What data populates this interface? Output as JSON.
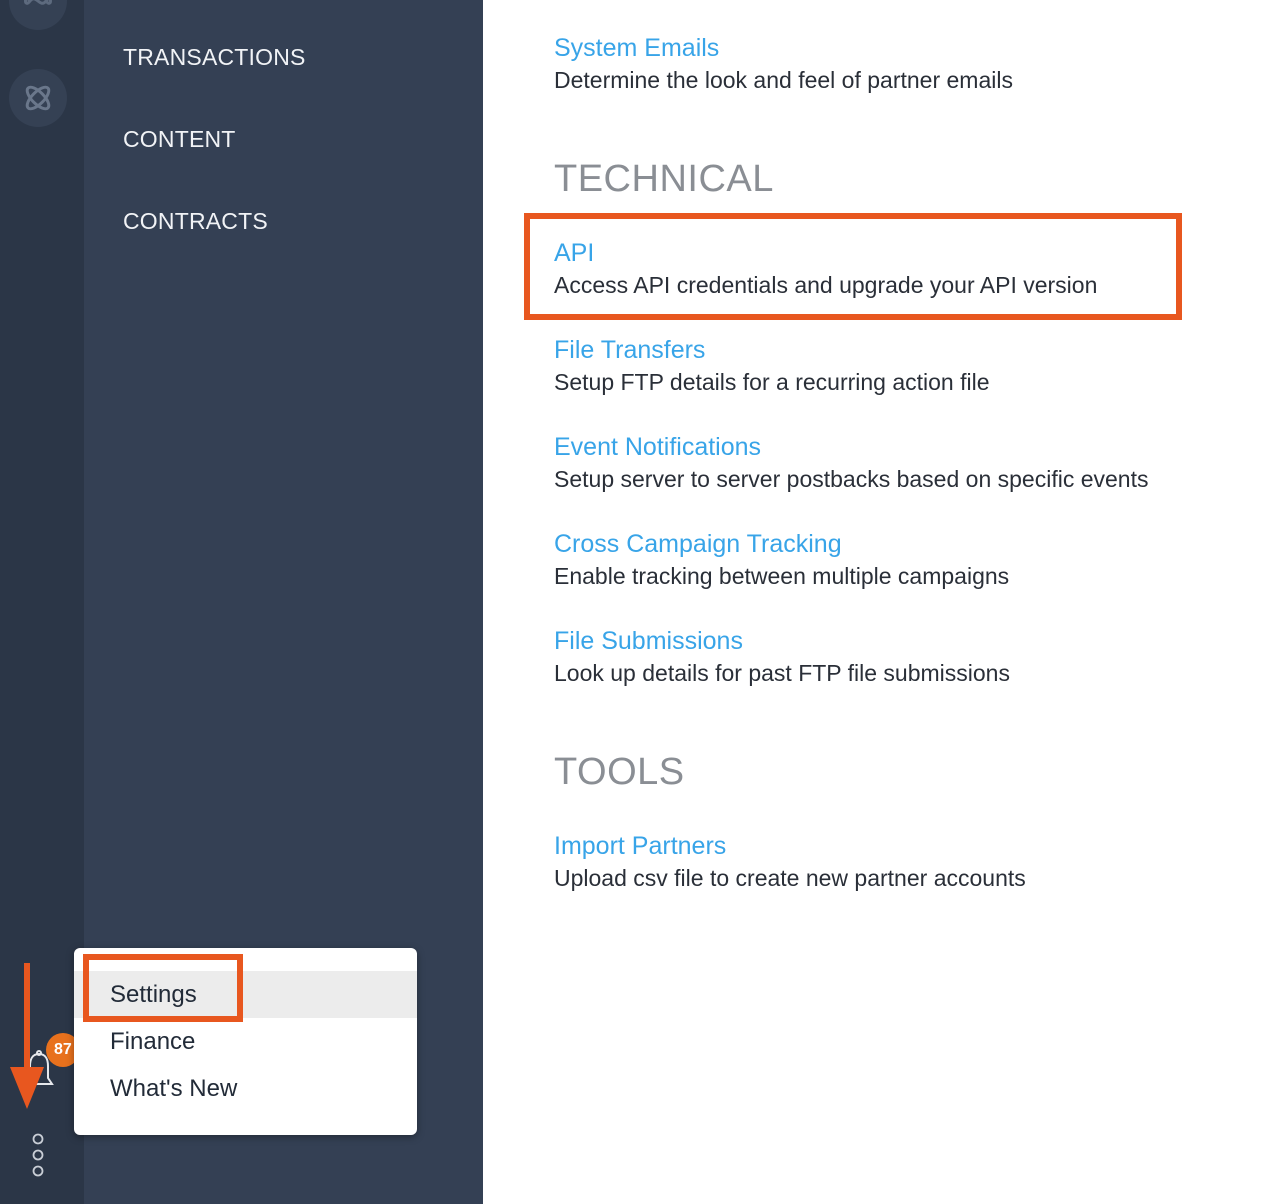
{
  "nav": {
    "items": [
      {
        "label": "TRANSACTIONS"
      },
      {
        "label": "CONTENT"
      },
      {
        "label": "CONTRACTS"
      }
    ]
  },
  "rail": {
    "notification_count": "87",
    "icons": [
      "infinity-icon",
      "atom-icon",
      "bell-icon",
      "more-dots-icon"
    ]
  },
  "popup_menu": {
    "items": [
      {
        "label": "Settings",
        "selected": true
      },
      {
        "label": "Finance"
      },
      {
        "label": "What's New"
      }
    ]
  },
  "content": {
    "top_item": {
      "title": "System Emails",
      "description": "Determine the look and feel of partner emails"
    },
    "sections": [
      {
        "heading": "TECHNICAL",
        "items": [
          {
            "title": "API",
            "description": "Access API credentials and upgrade your API version"
          },
          {
            "title": "File Transfers",
            "description": "Setup FTP details for a recurring action file"
          },
          {
            "title": "Event Notifications",
            "description": "Setup server to server postbacks based on specific events"
          },
          {
            "title": "Cross Campaign Tracking",
            "description": "Enable tracking between multiple campaigns"
          },
          {
            "title": "File Submissions",
            "description": "Look up details for past FTP file submissions"
          }
        ]
      },
      {
        "heading": "TOOLS",
        "items": [
          {
            "title": "Import Partners",
            "description": "Upload csv file to create new partner accounts"
          }
        ]
      }
    ]
  },
  "colors": {
    "rail_bg": "#2b3647",
    "nav_bg": "#344054",
    "link": "#38a4e8",
    "highlight": "#e8571f",
    "badge": "#e8711d"
  }
}
